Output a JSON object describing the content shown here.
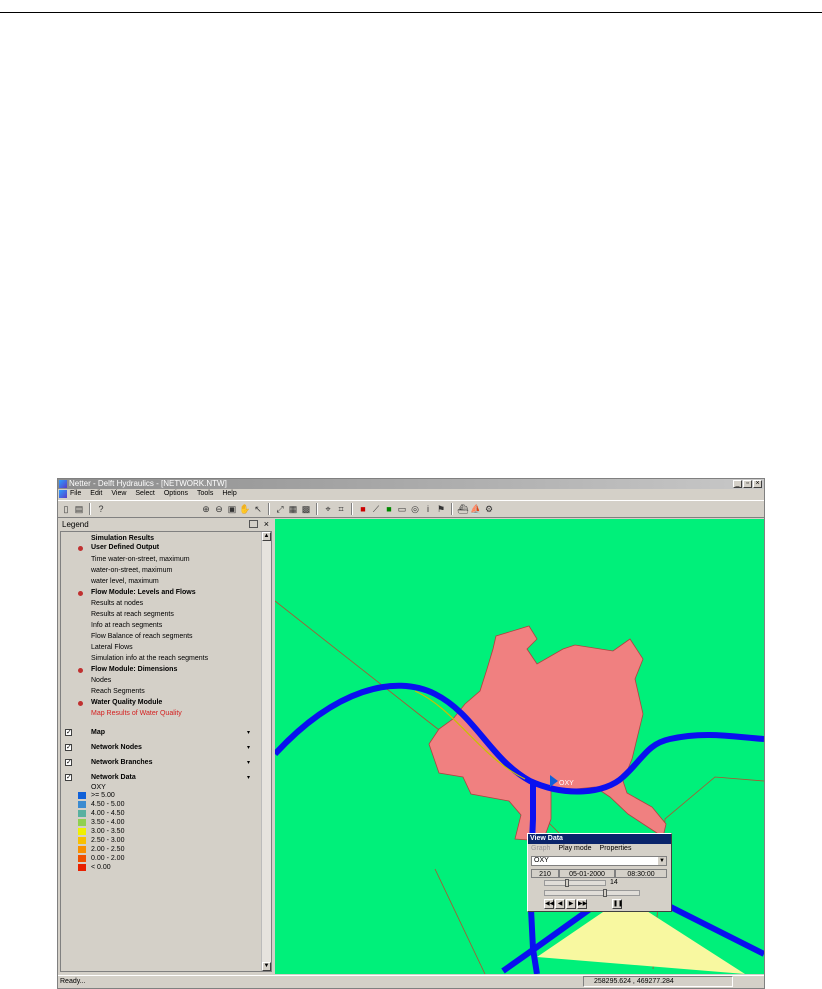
{
  "window": {
    "title": "Netter - Delft Hydraulics - [NETWORK.NTW]",
    "controls": [
      "_",
      "▫",
      "×"
    ]
  },
  "menu": [
    "File",
    "Edit",
    "View",
    "Select",
    "Options",
    "Tools",
    "Help"
  ],
  "legend": {
    "title": "Legend",
    "close": "×",
    "sections": {
      "simulation_results": "Simulation Results",
      "user_defined_output": "User Defined Output",
      "udo_items": [
        "Time water-on-street, maximum",
        "water-on-street, maximum",
        "water level, maximum"
      ],
      "flow_levels": "Flow Module: Levels and Flows",
      "flow_items": [
        "Results at nodes",
        "Results at reach segments",
        "Info at reach segments",
        "Flow Balance of reach segments",
        "Lateral Flows",
        "Simulation info at the reach segments"
      ],
      "flow_dimensions": "Flow Module: Dimensions",
      "dim_items": [
        "Nodes",
        "Reach Segments"
      ],
      "water_quality": "Water Quality Module",
      "wq_active": "Map Results of Water Quality"
    },
    "layers": [
      "Map",
      "Network Nodes",
      "Network Branches",
      "Network Data"
    ],
    "network_data_param": "OXY",
    "classes": [
      {
        "label": ">= 5.00",
        "color": "#1060d8"
      },
      {
        "label": "4.50 - 5.00",
        "color": "#3a8ad0"
      },
      {
        "label": "4.00 - 4.50",
        "color": "#58b0a0"
      },
      {
        "label": "3.50 - 4.00",
        "color": "#90d050"
      },
      {
        "label": "3.00 - 3.50",
        "color": "#f0f000"
      },
      {
        "label": "2.50 - 3.00",
        "color": "#f8c000"
      },
      {
        "label": "2.00 - 2.50",
        "color": "#f89000"
      },
      {
        "label": "0.00 - 2.00",
        "color": "#f05000"
      },
      {
        "label": "< 0.00",
        "color": "#e82000"
      }
    ]
  },
  "view_data": {
    "title": "View Data",
    "menu": {
      "graph": "Graph",
      "play_mode": "Play mode",
      "properties": "Properties"
    },
    "parameter": "OXY",
    "step": "210",
    "date": "05-01-2000",
    "time": "08:30:00",
    "speed_value": "14",
    "marker_label": "OXY"
  },
  "status": {
    "left": "Ready...",
    "coords": "258295.624 , 469277.284"
  },
  "colors": {
    "land": "#00f07a",
    "urban": "#f08080",
    "river": "#0a10f0",
    "sand": "#f8f8a0",
    "title_active": "#0a246a"
  }
}
